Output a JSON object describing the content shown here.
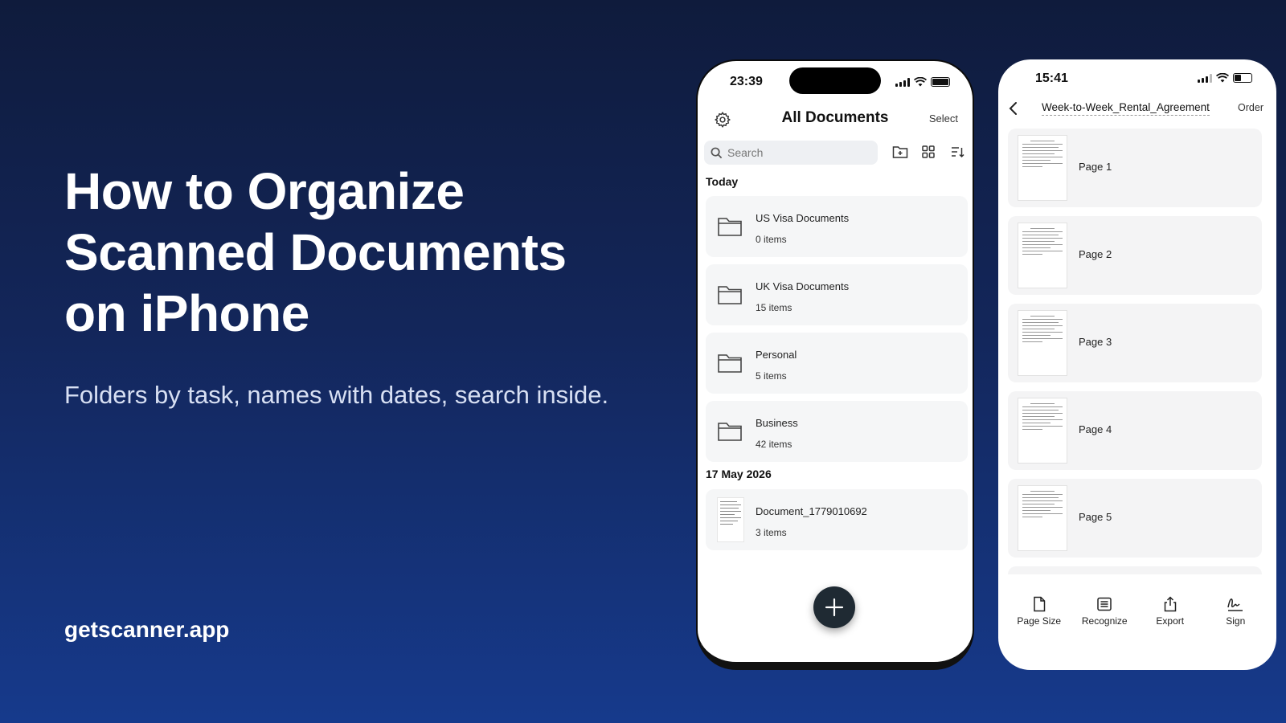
{
  "hero": {
    "title_lines": [
      "How to Organize",
      "Scanned Documents",
      "on iPhone"
    ],
    "subtitle": "Folders by task, names with dates, search inside.",
    "site": "getscanner.app"
  },
  "phone1": {
    "time": "23:39",
    "title": "All Documents",
    "select": "Select",
    "search_placeholder": "Search",
    "section_today": "Today",
    "folders": [
      {
        "name": "US Visa Documents",
        "count": "0 items"
      },
      {
        "name": "UK Visa Documents",
        "count": "15 items"
      },
      {
        "name": "Personal",
        "count": "5 items"
      },
      {
        "name": "Business",
        "count": "42 items"
      }
    ],
    "section_date": "17 May 2026",
    "document": {
      "name": "Document_1779010692",
      "count": "3 items"
    }
  },
  "phone2": {
    "time": "15:41",
    "doc_title": "Week-to-Week_Rental_Agreement",
    "order": "Order",
    "pages": [
      "Page 1",
      "Page 2",
      "Page 3",
      "Page 4",
      "Page 5"
    ],
    "tools": [
      "Page Size",
      "Recognize",
      "Export",
      "Sign"
    ]
  },
  "icons": [
    "gear-icon",
    "search-icon",
    "new-folder-icon",
    "grid-view-icon",
    "sort-icon",
    "folder-icon",
    "plus-icon",
    "back-chevron-icon",
    "page-size-icon",
    "recognize-icon",
    "export-icon",
    "sign-icon"
  ]
}
